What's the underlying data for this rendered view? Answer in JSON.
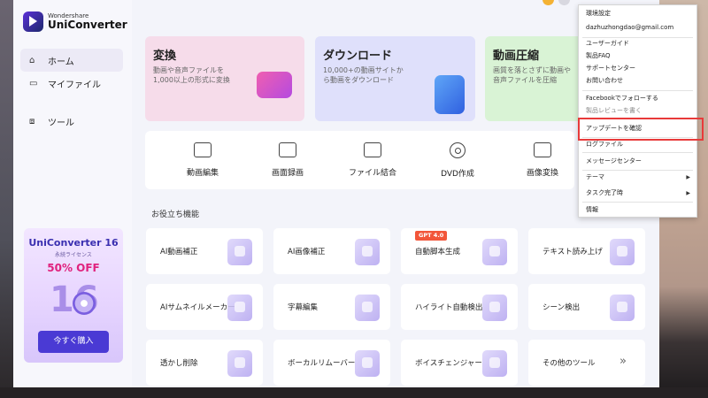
{
  "app": {
    "logo_small": "Wondershare",
    "logo_big": "UniConverter"
  },
  "sidebar": {
    "items": [
      {
        "label": "ホーム",
        "icon": "home-icon"
      },
      {
        "label": "マイファイル",
        "icon": "folder-icon"
      },
      {
        "label": "ツール",
        "icon": "toolbox-icon"
      }
    ]
  },
  "promo": {
    "title": "UniConverter 16",
    "subtitle": "永続ライセンス",
    "discount": "50% OFF",
    "button": "今すぐ購入"
  },
  "features": [
    {
      "title": "変換",
      "desc": "動画や音声ファイルを1,000以上の形式に変換",
      "color": "#f6dcea"
    },
    {
      "title": "ダウンロード",
      "desc": "10,000+の動画サイトから動画をダウンロード",
      "color": "#dfe0fb"
    },
    {
      "title": "動画圧縮",
      "desc": "画質を落とさずに動画や音声ファイルを圧縮",
      "color": "#d9f3d5"
    }
  ],
  "tools": [
    {
      "label": "動画編集",
      "icon": "video-edit-icon"
    },
    {
      "label": "画面録画",
      "icon": "screen-record-icon"
    },
    {
      "label": "ファイル結合",
      "icon": "file-merge-icon"
    },
    {
      "label": "DVD作成",
      "icon": "dvd-icon"
    },
    {
      "label": "画像変換",
      "icon": "image-convert-icon"
    }
  ],
  "useful": {
    "title": "お役立ち機能",
    "badge": "GPT 4.0",
    "cards": [
      [
        "AI動画補正",
        "AI画像補正",
        "自動脚本生成",
        "テキスト読み上げ"
      ],
      [
        "AIサムネイルメーカー",
        "字幕編集",
        "ハイライト自動検出",
        "シーン検出"
      ],
      [
        "透かし削除",
        "ボーカルリムーバー",
        "ボイスチェンジャー",
        "その他のツール"
      ]
    ],
    "more_icon": "double-chevron-right-icon"
  },
  "menu": {
    "items": [
      "環境設定",
      "dazhuzhongdao@gmail.com",
      "ユーザーガイド",
      "製品FAQ",
      "サポートセンター",
      "お問い合わせ",
      "Facebookでフォローする",
      "製品レビューを書く",
      "アップデートを確認",
      "ログファイル",
      "メッセージセンター",
      "テーマ",
      "タスク完了時",
      "情報"
    ],
    "highlight_color": "#e83a3a"
  }
}
